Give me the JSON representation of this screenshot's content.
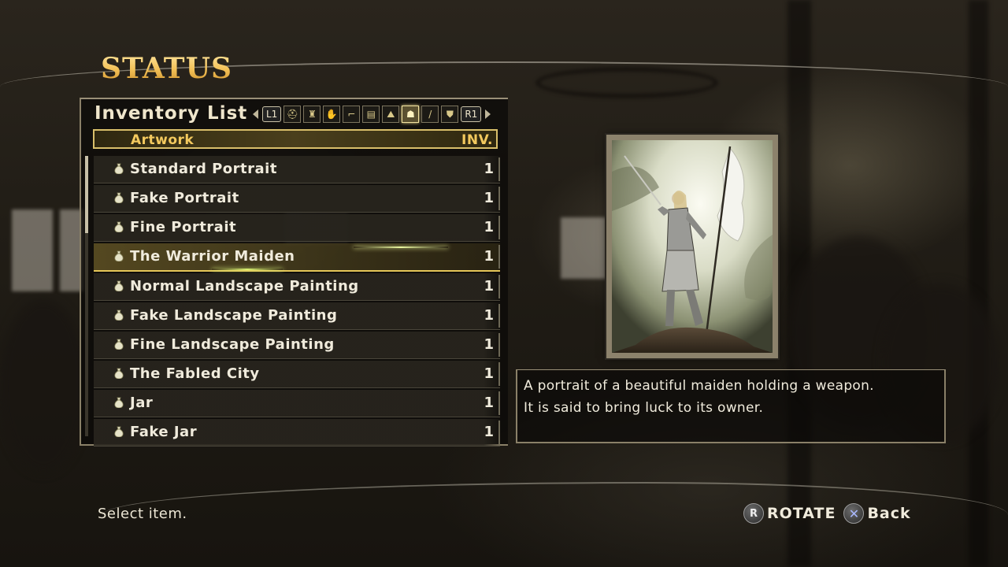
{
  "screen_title": "STATUS",
  "panel": {
    "title": "Inventory List",
    "shoulder_left": "L1",
    "shoulder_right": "R1",
    "categories": [
      {
        "icon": "helmet-icon",
        "glyph": "⛑"
      },
      {
        "icon": "armor-icon",
        "glyph": "♜"
      },
      {
        "icon": "gauntlet-icon",
        "glyph": "✋"
      },
      {
        "icon": "boots-icon",
        "glyph": "⌐"
      },
      {
        "icon": "book-icon",
        "glyph": "▤"
      },
      {
        "icon": "map-icon",
        "glyph": "⛰"
      },
      {
        "icon": "bag-icon",
        "glyph": "☗",
        "active": true
      },
      {
        "icon": "sword-icon",
        "glyph": "/"
      },
      {
        "icon": "shield-icon",
        "glyph": "⛊"
      }
    ],
    "category_name": "Artwork",
    "inv_header": "INV.",
    "items": [
      {
        "name": "Standard Portrait",
        "qty": "1"
      },
      {
        "name": "Fake Portrait",
        "qty": "1"
      },
      {
        "name": "Fine Portrait",
        "qty": "1"
      },
      {
        "name": "The Warrior Maiden",
        "qty": "1",
        "selected": true
      },
      {
        "name": "Normal Landscape Painting",
        "qty": "1"
      },
      {
        "name": "Fake Landscape Painting",
        "qty": "1"
      },
      {
        "name": "Fine Landscape Painting",
        "qty": "1"
      },
      {
        "name": "The Fabled City",
        "qty": "1"
      },
      {
        "name": "Jar",
        "qty": "1"
      },
      {
        "name": "Fake Jar",
        "qty": "1"
      }
    ]
  },
  "description": "A portrait of a beautiful maiden holding a weapon.\n It is said to bring luck to its owner.",
  "footer": {
    "hint": "Select item.",
    "rotate_button": "R",
    "rotate_label": "ROTATE",
    "back_button": "✕",
    "back_label": "Back"
  },
  "colors": {
    "title_gold": "#f2bf55",
    "selection_border": "#e5c658",
    "panel_border": "#8a8068"
  }
}
